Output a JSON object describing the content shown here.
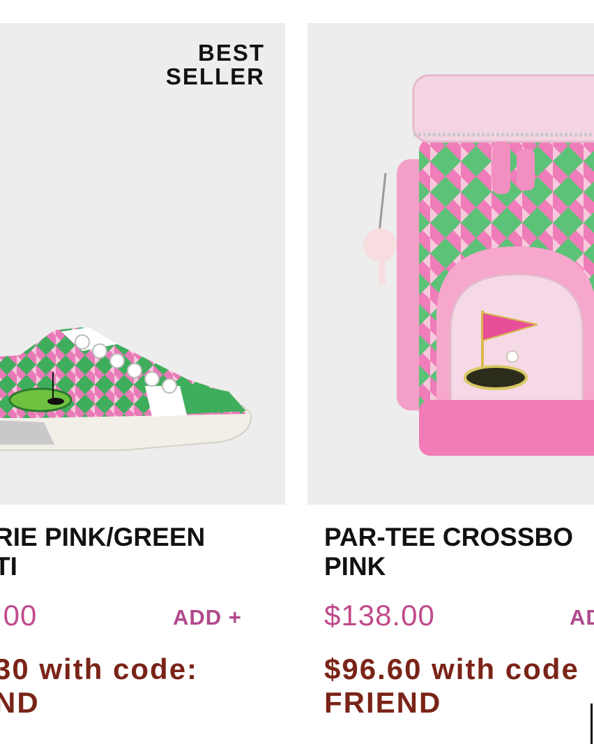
{
  "products": [
    {
      "badge": [
        "BEST",
        "SELLER"
      ],
      "title_lines": [
        "RIE PINK/GREEN",
        "TI"
      ],
      "price": ".00",
      "add_label": "ADD +",
      "promo_lines": [
        "30 with code:",
        "ND"
      ],
      "image_icon": "argyle-sneaker-image"
    },
    {
      "title_lines": [
        "PAR-TEE CROSSBO",
        "PINK"
      ],
      "price": "$138.00",
      "add_label": "AD",
      "promo_lines": [
        "$96.60 with code",
        "FRIEND"
      ],
      "image_icon": "golf-bag-crossbody-image"
    }
  ],
  "colors": {
    "image_bg": "#ededed",
    "price": "#c04a8c",
    "promo": "#7a2418",
    "title": "#111111"
  }
}
